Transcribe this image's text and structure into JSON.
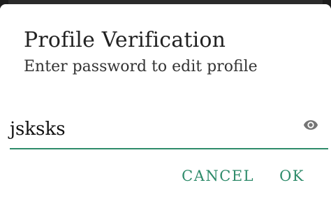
{
  "dialog": {
    "title": "Profile Verification",
    "message": "Enter password to edit profile",
    "password_field": {
      "value": "jsksks",
      "visibility_icon": "eye-icon"
    },
    "buttons": {
      "cancel_label": "CANCEL",
      "ok_label": "OK"
    }
  },
  "colors": {
    "accent": "#2e8b6a",
    "title_text": "#222222",
    "icon": "#757575"
  }
}
